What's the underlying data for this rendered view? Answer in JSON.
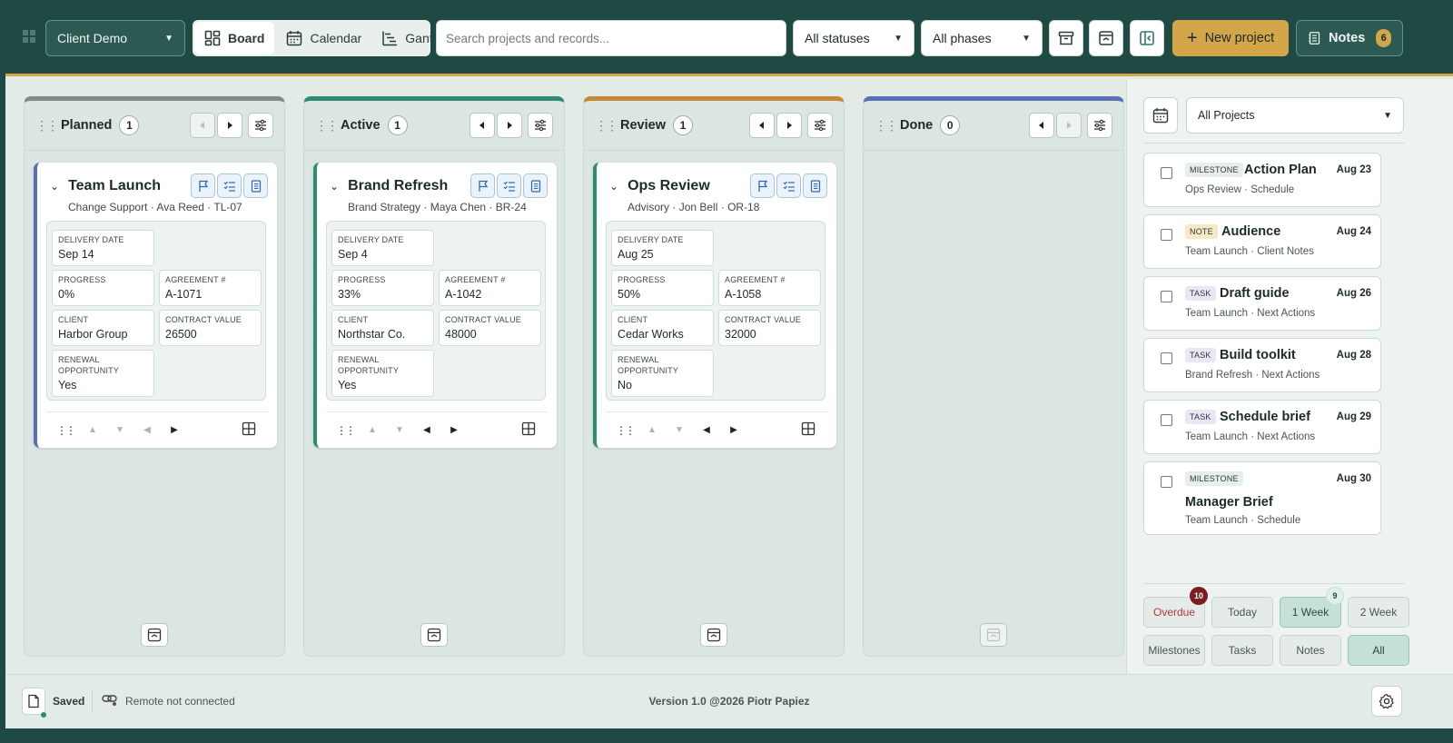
{
  "header": {
    "client": "Client Demo",
    "views": [
      {
        "label": "Board",
        "active": true
      },
      {
        "label": "Calendar",
        "active": false
      },
      {
        "label": "Gantt",
        "active": false
      }
    ],
    "search_placeholder": "Search projects and records...",
    "status_filter": "All statuses",
    "phase_filter": "All phases",
    "new_project": "New project",
    "notes_label": "Notes",
    "notes_count": "6",
    "accent": "#d4a64a",
    "brand": "#1f4a44"
  },
  "columns": [
    {
      "title": "Planned",
      "count": "1",
      "color": "#7f8c89"
    },
    {
      "title": "Active",
      "count": "1",
      "color": "#2e8b74"
    },
    {
      "title": "Review",
      "count": "1",
      "color": "#c48a3a"
    },
    {
      "title": "Done",
      "count": "0",
      "color": "#5b6fb5"
    }
  ],
  "cards": [
    {
      "title": "Team Launch",
      "phase": "Change Support",
      "owner": "Ava Reed",
      "code": "TL-07",
      "delivery_label": "DELIVERY DATE",
      "delivery": "Sep 14",
      "progress_label": "PROGRESS",
      "progress": "0%",
      "agreement_label": "AGREEMENT #",
      "agreement": "A-1071",
      "client_label": "CLIENT",
      "client": "Harbor Group",
      "value_label": "CONTRACT VALUE",
      "value": "26500",
      "renewal_label": "RENEWAL OPPORTUNITY",
      "renewal": "Yes"
    },
    {
      "title": "Brand Refresh",
      "phase": "Brand Strategy",
      "owner": "Maya Chen",
      "code": "BR-24",
      "delivery_label": "DELIVERY DATE",
      "delivery": "Sep 4",
      "progress_label": "PROGRESS",
      "progress": "33%",
      "agreement_label": "AGREEMENT #",
      "agreement": "A-1042",
      "client_label": "CLIENT",
      "client": "Northstar Co.",
      "value_label": "CONTRACT VALUE",
      "value": "48000",
      "renewal_label": "RENEWAL OPPORTUNITY",
      "renewal": "Yes"
    },
    {
      "title": "Ops Review",
      "phase": "Advisory",
      "owner": "Jon Bell",
      "code": "OR-18",
      "delivery_label": "DELIVERY DATE",
      "delivery": "Aug 25",
      "progress_label": "PROGRESS",
      "progress": "50%",
      "agreement_label": "AGREEMENT #",
      "agreement": "A-1058",
      "client_label": "CLIENT",
      "client": "Cedar Works",
      "value_label": "CONTRACT VALUE",
      "value": "32000",
      "renewal_label": "RENEWAL OPPORTUNITY",
      "renewal": "No"
    }
  ],
  "panel": {
    "project_filter": "All Projects",
    "items": [
      {
        "tag": "MILESTONE",
        "title": "Action Plan",
        "sub": "Ops Review · Schedule",
        "date": "Aug 23"
      },
      {
        "tag": "NOTE",
        "title": "Audience",
        "sub": "Team Launch · Client Notes",
        "date": "Aug 24"
      },
      {
        "tag": "TASK",
        "title": "Draft guide",
        "sub": "Team Launch · Next Actions",
        "date": "Aug 26"
      },
      {
        "tag": "TASK",
        "title": "Build toolkit",
        "sub": "Brand Refresh · Next Actions",
        "date": "Aug 28"
      },
      {
        "tag": "TASK",
        "title": "Schedule brief",
        "sub": "Team Launch · Next Actions",
        "date": "Aug 29"
      },
      {
        "tag": "MILESTONE",
        "title": "Manager Brief",
        "sub": "Team Launch · Schedule",
        "date": "Aug 30"
      }
    ],
    "range_filters": [
      {
        "label": "Overdue",
        "badge": "10"
      },
      {
        "label": "Today",
        "badge": ""
      },
      {
        "label": "1 Week",
        "badge": "9"
      },
      {
        "label": "2 Week",
        "badge": ""
      }
    ],
    "type_filters": [
      {
        "label": "Milestones"
      },
      {
        "label": "Tasks"
      },
      {
        "label": "Notes"
      },
      {
        "label": "All"
      }
    ]
  },
  "footer": {
    "saved": "Saved",
    "remote": "Remote not connected",
    "version": "Version 1.0 @2026 Piotr Papiez"
  }
}
